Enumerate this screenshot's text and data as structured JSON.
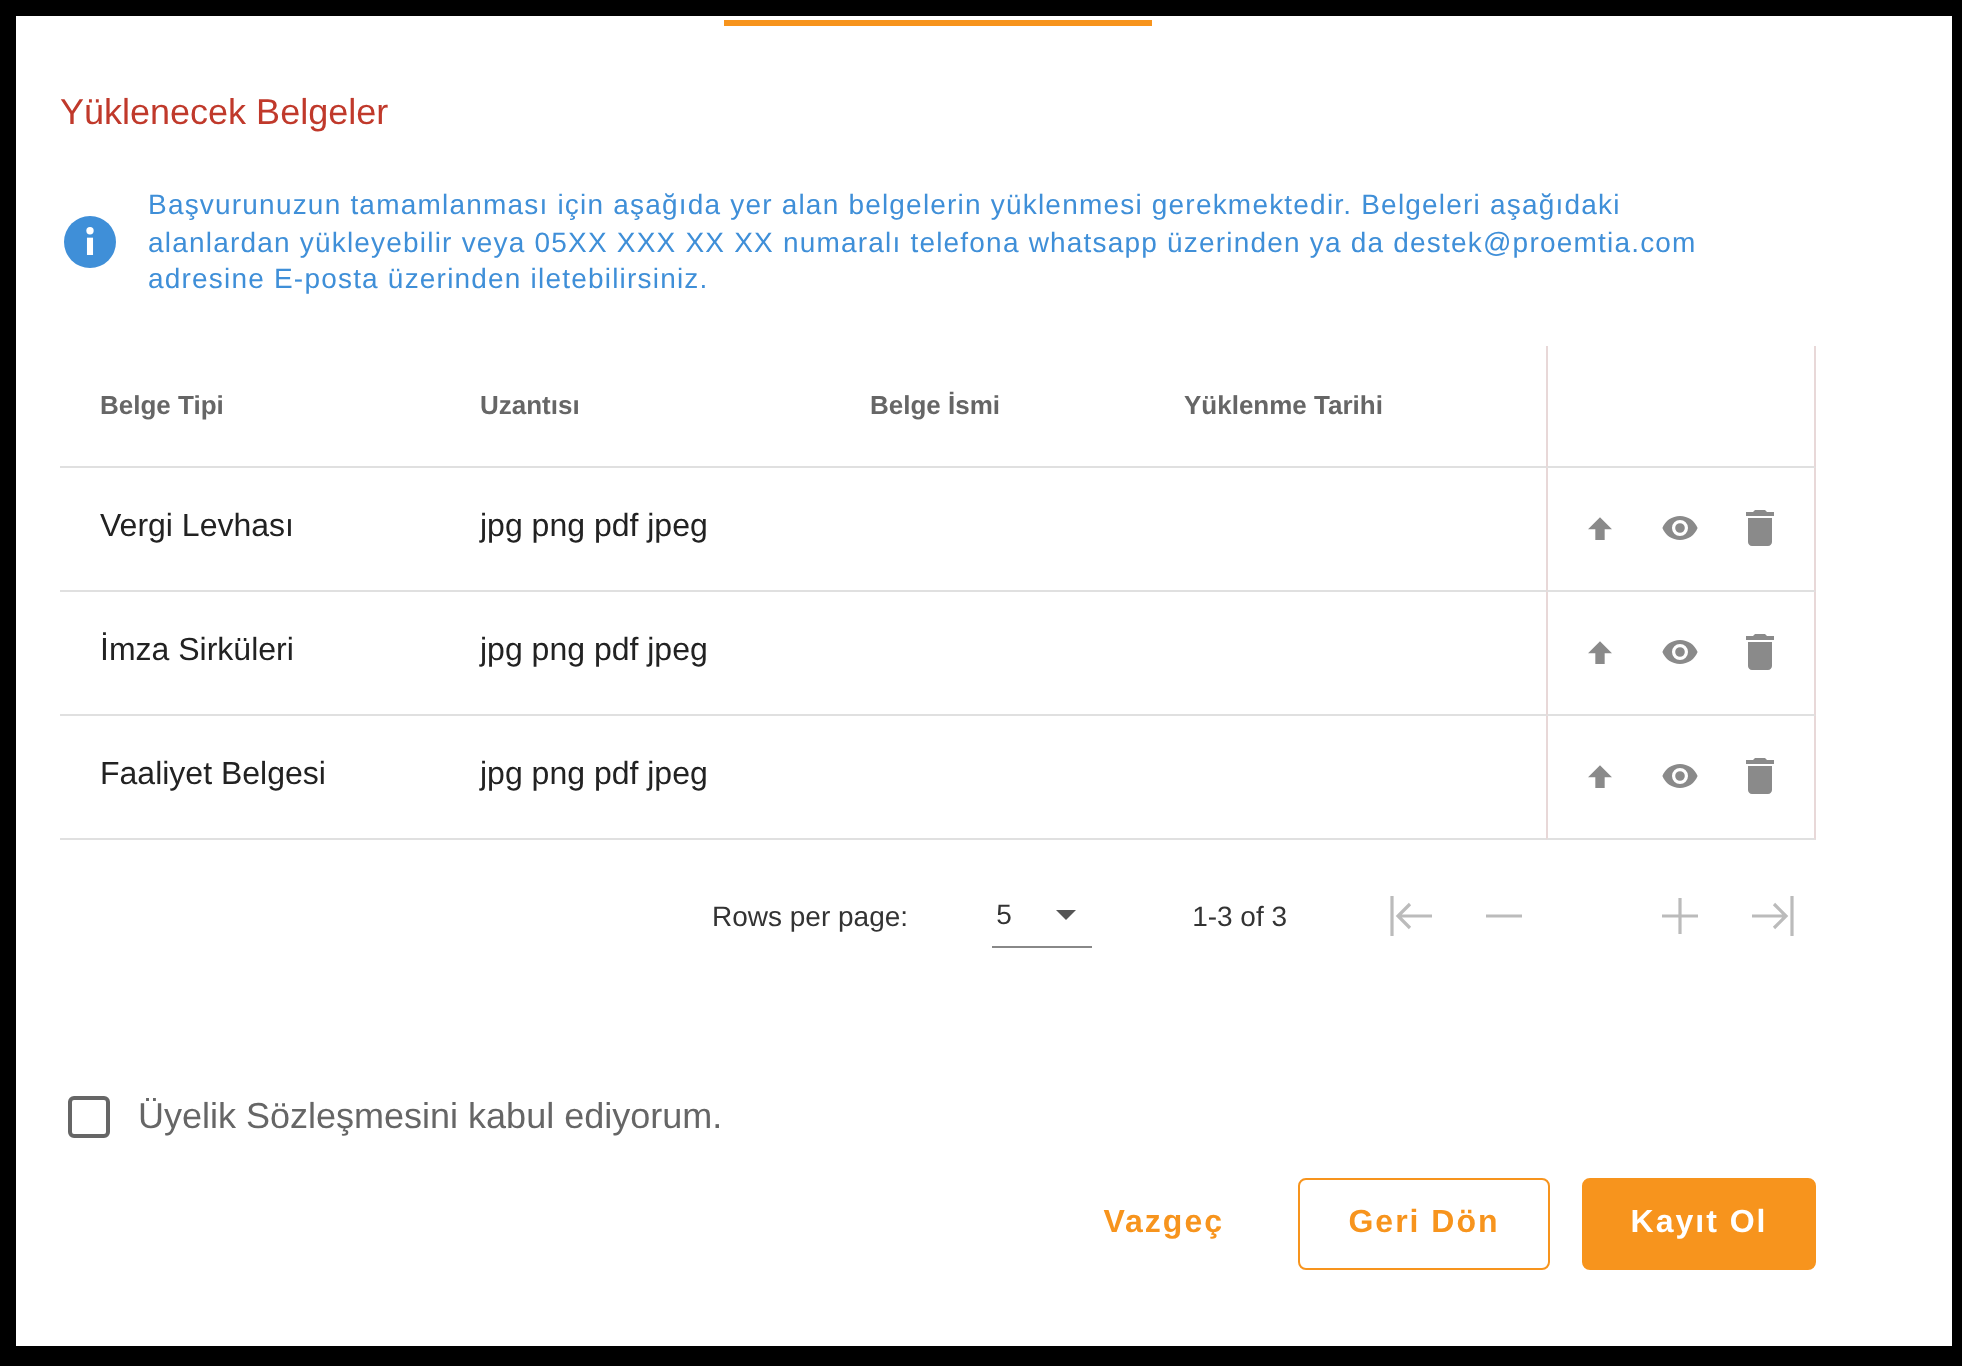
{
  "section_title": "Yüklenecek Belgeler",
  "info_text": "Başvurunuzun tamamlanması için aşağıda yer alan belgelerin yüklenmesi gerekmektedir. Belgeleri aşağıdaki alanlardan yükleyebilir veya 05XX XXX XX XX numaralı telefona whatsapp üzerinden ya da destek@proemtia.com adresine E-posta üzerinden iletebilirsiniz.",
  "table": {
    "columns": [
      "Belge Tipi",
      "Uzantısı",
      "Belge İsmi",
      "Yüklenme Tarihi"
    ],
    "rows": [
      {
        "type": "Vergi Levhası",
        "extensions": "jpg png pdf jpeg"
      },
      {
        "type": "İmza Sirküleri",
        "extensions": "jpg png pdf jpeg"
      },
      {
        "type": "Faaliyet Belgesi",
        "extensions": "jpg png pdf jpeg"
      }
    ]
  },
  "pagination": {
    "rows_per_page_label": "Rows per page:",
    "rows_per_page": "5",
    "range": "1-3 of 3"
  },
  "agreement": {
    "label": "Üyelik Sözleşmesini kabul ediyorum.",
    "checked": false
  },
  "buttons": [
    {
      "label": "Vazgeç",
      "kind": "text"
    },
    {
      "label": "Geri Dön",
      "kind": "outlined"
    },
    {
      "label": "Kayıt Ol",
      "kind": "filled"
    }
  ]
}
